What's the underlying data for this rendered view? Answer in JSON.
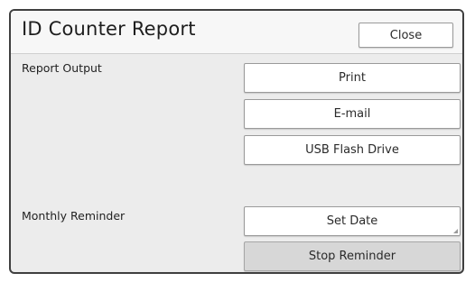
{
  "header": {
    "title": "ID Counter Report",
    "close_label": "Close"
  },
  "report_output": {
    "label": "Report Output",
    "buttons": [
      "Print",
      "E-mail",
      "USB Flash Drive"
    ]
  },
  "monthly_reminder": {
    "label": "Monthly Reminder",
    "set_date_label": "Set Date",
    "stop_reminder_label": "Stop Reminder",
    "active": "Stop Reminder"
  },
  "colors": {
    "panel_background": "#ececec",
    "header_background": "#f7f7f7",
    "button_background": "#ffffff",
    "active_button_background": "#d7d7d7",
    "border": "#3f3f3f"
  }
}
